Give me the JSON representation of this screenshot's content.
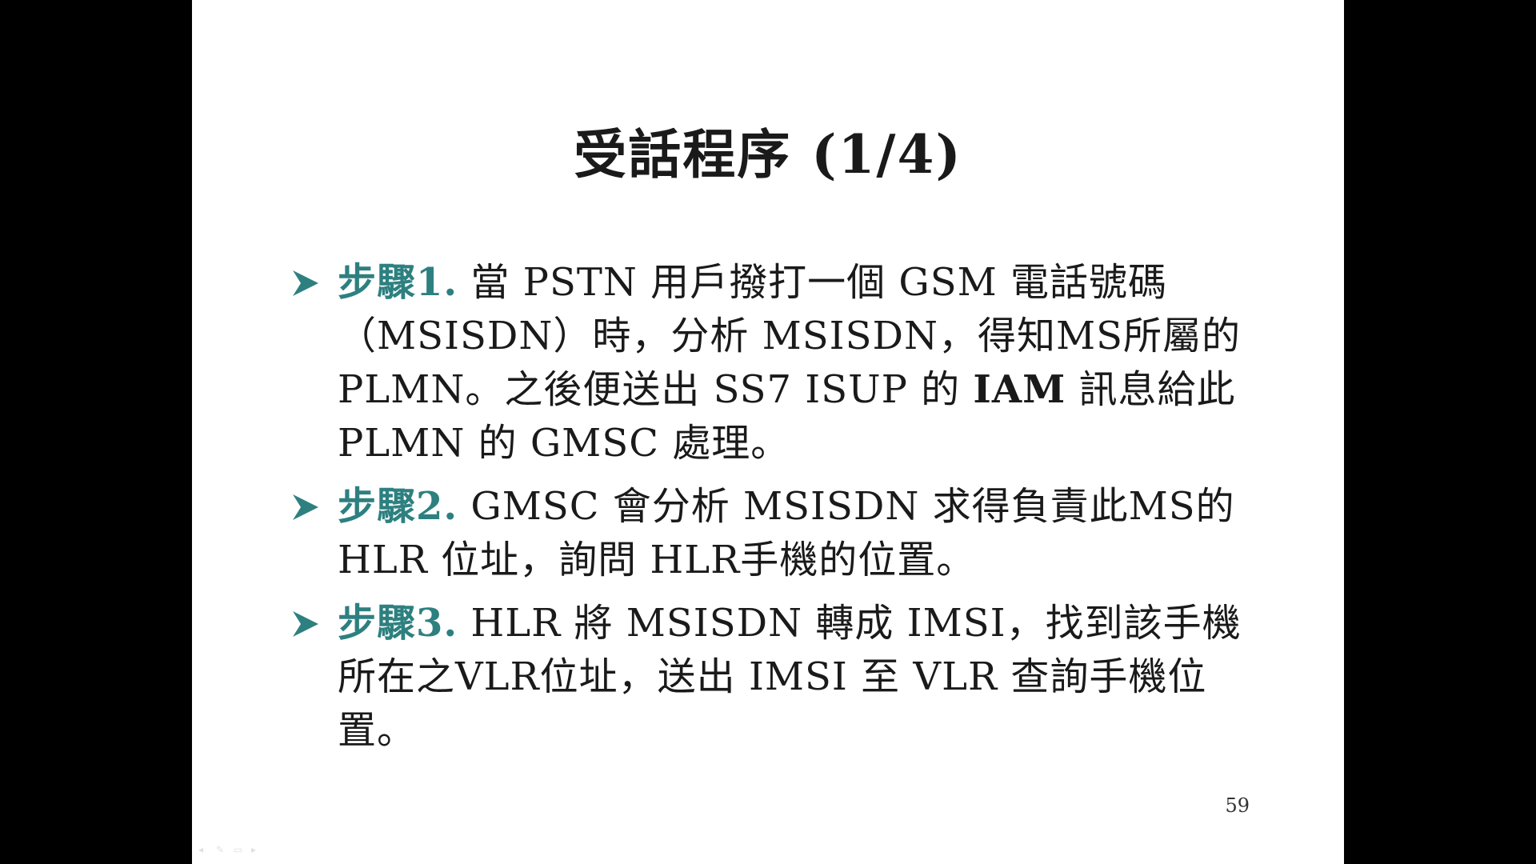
{
  "slide": {
    "title": "受話程序 (1/4)",
    "page_number": "59",
    "colors": {
      "step_label": "#2e8080",
      "bullet_marker": "#2e8080",
      "background": "#ffffff",
      "letterbox": "#000000"
    },
    "bullets": [
      {
        "label": "步驟1.",
        "text_before": " 當 PSTN 用戶撥打一個 GSM 電話號碼（MSISDN）時，分析 MSISDN，得知MS所屬的 PLMN。之後便送出 SS7 ISUP 的 ",
        "emphasis": "IAM",
        "text_after": " 訊息給此 PLMN 的 GMSC 處理。"
      },
      {
        "label": "步驟2.",
        "text": " GMSC 會分析 MSISDN 求得負責此MS的 HLR 位址，詢問 HLR手機的位置。"
      },
      {
        "label": "步驟3.",
        "text": " HLR 將 MSISDN 轉成 IMSI，找到該手機所在之VLR位址，送出 IMSI 至 VLR 查詢手機位置。"
      }
    ],
    "controls": {
      "prev_icon": "◂",
      "pen_icon": "✎",
      "menu_icon": "▭",
      "next_icon": "▸"
    }
  }
}
